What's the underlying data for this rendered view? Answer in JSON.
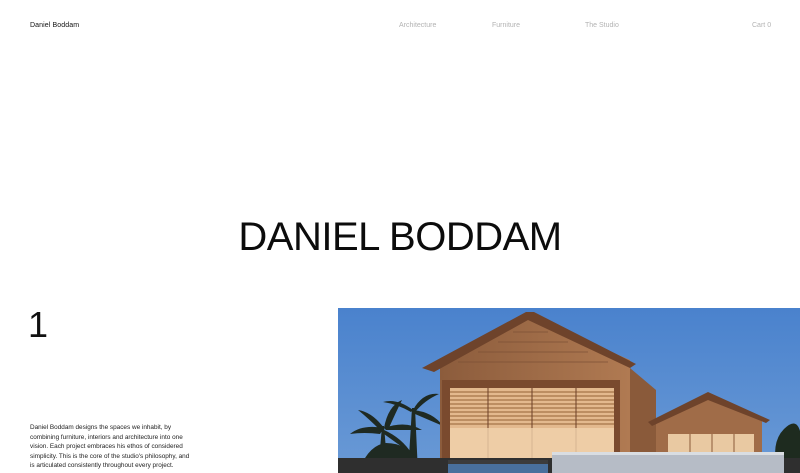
{
  "header": {
    "brand": "Daniel Boddam",
    "nav": [
      {
        "label": "Architecture"
      },
      {
        "label": "Furniture"
      },
      {
        "label": "The Studio"
      }
    ],
    "cart_label": "Cart",
    "cart_count": "0"
  },
  "hero": {
    "title": "DANIEL BODDAM"
  },
  "section": {
    "number": "1",
    "intro": "Daniel Boddam designs the spaces we inhabit, by combining furniture, interiors and architecture into one vision. Each project embraces his ethos of considered simplicity. This is the core of the studio's philosophy, and is articulated consistently throughout every project."
  },
  "image": {
    "subject": "timber-clad-house-photo",
    "sky_color": "#4f86cf",
    "timber_color": "#9b6a47"
  }
}
